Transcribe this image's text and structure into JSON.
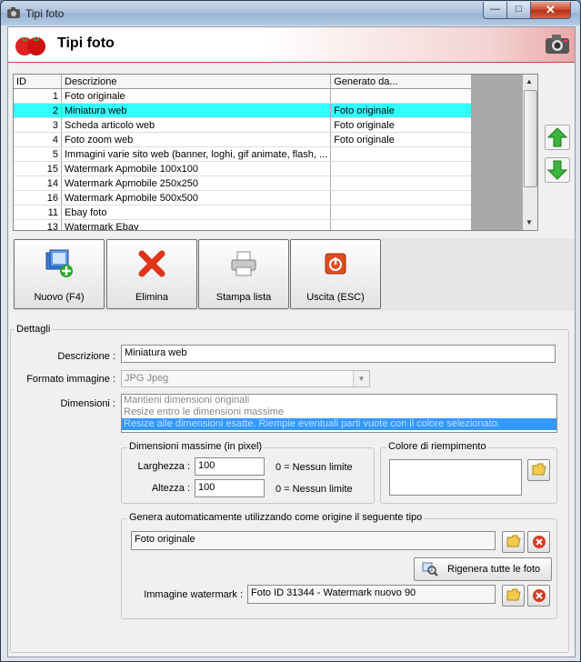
{
  "window": {
    "title": "Tipi foto",
    "minimize": "—",
    "maximize": "□",
    "close": "✕"
  },
  "header": {
    "title": "Tipi foto"
  },
  "grid": {
    "columns": [
      "ID",
      "Descrizione",
      "Generato da..."
    ],
    "rows": [
      {
        "id": "1",
        "descrizione": "Foto originale",
        "generato": ""
      },
      {
        "id": "2",
        "descrizione": "Miniatura web",
        "generato": "Foto originale"
      },
      {
        "id": "3",
        "descrizione": "Scheda articolo web",
        "generato": "Foto originale"
      },
      {
        "id": "4",
        "descrizione": "Foto zoom web",
        "generato": "Foto originale"
      },
      {
        "id": "5",
        "descrizione": "Immagini varie sito web (banner, loghi, gif animate, flash, ...",
        "generato": ""
      },
      {
        "id": "15",
        "descrizione": "Watermark Apmobile 100x100",
        "generato": ""
      },
      {
        "id": "14",
        "descrizione": "Watermark Apmobile 250x250",
        "generato": ""
      },
      {
        "id": "16",
        "descrizione": "Watermark Apmobile 500x500",
        "generato": ""
      },
      {
        "id": "11",
        "descrizione": "Ebay foto",
        "generato": ""
      },
      {
        "id": "13",
        "descrizione": "Watermark Ebay",
        "generato": ""
      }
    ],
    "selected_id": "2"
  },
  "toolbar": {
    "nuovo": "Nuovo (F4)",
    "elimina": "Elimina",
    "stampa": "Stampa lista",
    "uscita": "Uscita (ESC)"
  },
  "dettagli": {
    "legend": "Dettagli",
    "descrizione_label": "Descrizione :",
    "descrizione_value": "Miniatura web",
    "formato_label": "Formato immagine :",
    "formato_value": "JPG Jpeg",
    "dimensioni_label": "Dimensioni :",
    "dimensioni_options": [
      "Mantieni dimensioni originali",
      "Resize entro le dimensioni massime",
      "Resize alle dimensioni esatte. Riempie eventuali parti vuote con il colore selezionato."
    ],
    "dimensioni_selected": "Resize alle dimensioni esatte. Riempie eventuali parti vuote con il colore selezionato.",
    "dim_massime_title": "Dimensioni massime (in pixel)",
    "larghezza_label": "Larghezza :",
    "larghezza_value": "100",
    "altezza_label": "Altezza :",
    "altezza_value": "100",
    "nessun_limite": "0 = Nessun limite",
    "colore_title": "Colore di riempimento",
    "genera_title": "Genera automaticamente utilizzando come origine il seguente tipo",
    "genera_value": "Foto originale",
    "rigenera_label": "Rigenera tutte le foto",
    "watermark_label": "Immagine watermark :",
    "watermark_value": "Foto ID 31344 - Watermark nuovo 90"
  },
  "colors": {
    "selected_row": "#33ffff",
    "list_selected": "#3399ff",
    "header_accent": "#e9a8a8"
  }
}
